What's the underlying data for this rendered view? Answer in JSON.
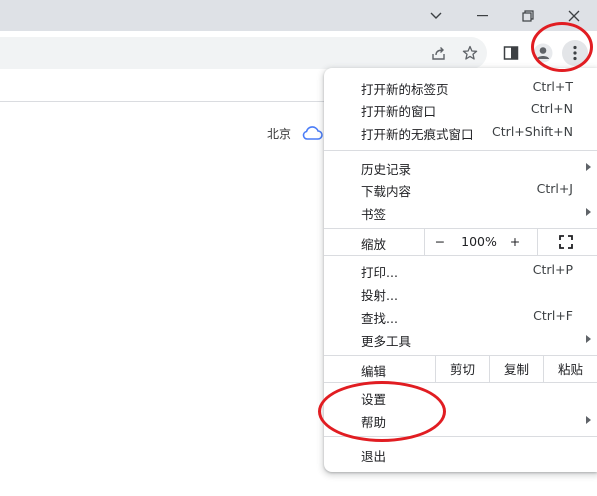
{
  "window": {
    "controls": [
      "chevron-down-icon",
      "minimize-icon",
      "restore-icon",
      "close-icon"
    ]
  },
  "toolbar": {
    "icons": [
      "share-icon",
      "star-icon",
      "side-panel-icon",
      "profile-icon",
      "more-vert-icon"
    ]
  },
  "page": {
    "weather_city": "北京",
    "weather_icon": "cloud-icon"
  },
  "menu": {
    "new_tab": {
      "label": "打开新的标签页",
      "shortcut": "Ctrl+T"
    },
    "new_window": {
      "label": "打开新的窗口",
      "shortcut": "Ctrl+N"
    },
    "incognito": {
      "label": "打开新的无痕式窗口",
      "shortcut": "Ctrl+Shift+N"
    },
    "history": {
      "label": "历史记录"
    },
    "downloads": {
      "label": "下载内容",
      "shortcut": "Ctrl+J"
    },
    "bookmarks": {
      "label": "书签"
    },
    "zoom": {
      "label": "缩放",
      "minus": "−",
      "value": "100%",
      "plus": "+"
    },
    "print": {
      "label": "打印...",
      "shortcut": "Ctrl+P"
    },
    "cast": {
      "label": "投射..."
    },
    "find": {
      "label": "查找...",
      "shortcut": "Ctrl+F"
    },
    "more_tools": {
      "label": "更多工具"
    },
    "edit": {
      "label": "编辑",
      "cut": "剪切",
      "copy": "复制",
      "paste": "粘贴"
    },
    "settings": {
      "label": "设置"
    },
    "help": {
      "label": "帮助"
    },
    "exit": {
      "label": "退出"
    }
  },
  "annotation": {
    "color": "#e11d22"
  }
}
